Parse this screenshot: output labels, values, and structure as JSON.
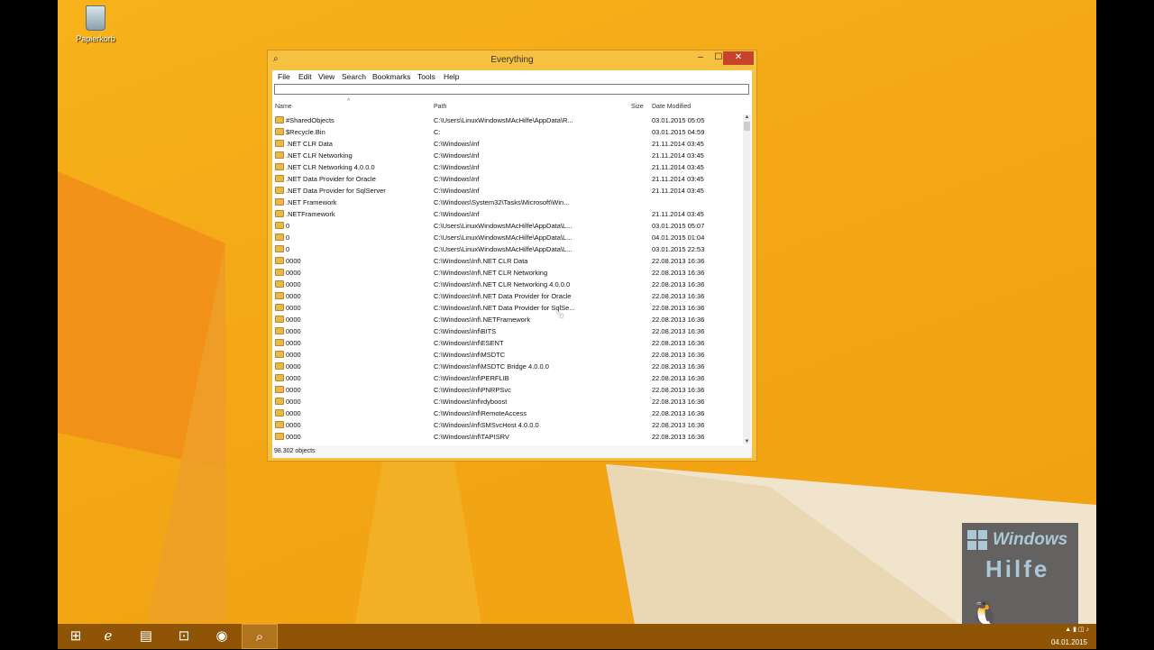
{
  "desktop": {
    "recycle_bin_label": "Papierkorb",
    "colors": {
      "wallpaper": "#f4a816",
      "taskbar": "#8f5405"
    }
  },
  "window": {
    "title": "Everything",
    "menus": [
      "File",
      "Edit",
      "View",
      "Search",
      "Bookmarks",
      "Tools",
      "Help"
    ],
    "search_value": "",
    "columns": {
      "name": "Name",
      "path": "Path",
      "size": "Size",
      "date": "Date Modified"
    },
    "rows": [
      {
        "name": "#SharedObjects",
        "path": "C:\\Users\\LinuxWindowsMAcHilfe\\AppData\\R...",
        "date": "03.01.2015 05:05"
      },
      {
        "name": "$Recycle.Bin",
        "path": "C:",
        "date": "03.01.2015 04:59"
      },
      {
        "name": ".NET CLR Data",
        "path": "C:\\Windows\\Inf",
        "date": "21.11.2014 03:45"
      },
      {
        "name": ".NET CLR Networking",
        "path": "C:\\Windows\\Inf",
        "date": "21.11.2014 03:45"
      },
      {
        "name": ".NET CLR Networking 4.0.0.0",
        "path": "C:\\Windows\\Inf",
        "date": "21.11.2014 03:45"
      },
      {
        "name": ".NET Data Provider for Oracle",
        "path": "C:\\Windows\\Inf",
        "date": "21.11.2014 03:45"
      },
      {
        "name": ".NET Data Provider for SqlServer",
        "path": "C:\\Windows\\Inf",
        "date": "21.11.2014 03:45"
      },
      {
        "name": ".NET Framework",
        "path": "C:\\Windows\\System32\\Tasks\\Microsoft\\Win...",
        "date": ""
      },
      {
        "name": ".NETFramework",
        "path": "C:\\Windows\\Inf",
        "date": "21.11.2014 03:45"
      },
      {
        "name": "0",
        "path": "C:\\Users\\LinuxWindowsMAcHilfe\\AppData\\L...",
        "date": "03.01.2015 05:07"
      },
      {
        "name": "0",
        "path": "C:\\Users\\LinuxWindowsMAcHilfe\\AppData\\L...",
        "date": "04.01.2015 01:04"
      },
      {
        "name": "0",
        "path": "C:\\Users\\LinuxWindowsMAcHilfe\\AppData\\L...",
        "date": "03.01.2015 22:53"
      },
      {
        "name": "0000",
        "path": "C:\\Windows\\Inf\\.NET CLR Data",
        "date": "22.08.2013 16:36"
      },
      {
        "name": "0000",
        "path": "C:\\Windows\\Inf\\.NET CLR Networking",
        "date": "22.08.2013 16:36"
      },
      {
        "name": "0000",
        "path": "C:\\Windows\\Inf\\.NET CLR Networking 4.0.0.0",
        "date": "22.08.2013 16:36"
      },
      {
        "name": "0000",
        "path": "C:\\Windows\\Inf\\.NET Data Provider for Oracle",
        "date": "22.08.2013 16:36"
      },
      {
        "name": "0000",
        "path": "C:\\Windows\\Inf\\.NET Data Provider for SqlSe...",
        "date": "22.08.2013 16:36"
      },
      {
        "name": "0000",
        "path": "C:\\Windows\\Inf\\.NETFramework",
        "date": "22.08.2013 16:36"
      },
      {
        "name": "0000",
        "path": "C:\\Windows\\Inf\\BITS",
        "date": "22.08.2013 16:36"
      },
      {
        "name": "0000",
        "path": "C:\\Windows\\Inf\\ESENT",
        "date": "22.08.2013 16:36"
      },
      {
        "name": "0000",
        "path": "C:\\Windows\\Inf\\MSDTC",
        "date": "22.08.2013 16:36"
      },
      {
        "name": "0000",
        "path": "C:\\Windows\\Inf\\MSDTC Bridge 4.0.0.0",
        "date": "22.08.2013 16:36"
      },
      {
        "name": "0000",
        "path": "C:\\Windows\\Inf\\PERFLIB",
        "date": "22.08.2013 16:36"
      },
      {
        "name": "0000",
        "path": "C:\\Windows\\Inf\\PNRPSvc",
        "date": "22.08.2013 16:36"
      },
      {
        "name": "0000",
        "path": "C:\\Windows\\Inf\\rdyboost",
        "date": "22.08.2013 16:36"
      },
      {
        "name": "0000",
        "path": "C:\\Windows\\Inf\\RemoteAccess",
        "date": "22.08.2013 16:36"
      },
      {
        "name": "0000",
        "path": "C:\\Windows\\Inf\\SMSvcHost 4.0.0.0",
        "date": "22.08.2013 16:36"
      },
      {
        "name": "0000",
        "path": "C:\\Windows\\Inf\\TAPISRV",
        "date": "22.08.2013 16:36"
      }
    ],
    "status": "98.302 objects"
  },
  "watermark": {
    "line1": "Windows",
    "line2": "Hilfe"
  },
  "taskbar": {
    "items": [
      "start-icon",
      "internet-explorer-icon",
      "file-explorer-icon",
      "store-icon",
      "firefox-icon",
      "everything-icon"
    ],
    "clock_date": "04.01.2015"
  }
}
